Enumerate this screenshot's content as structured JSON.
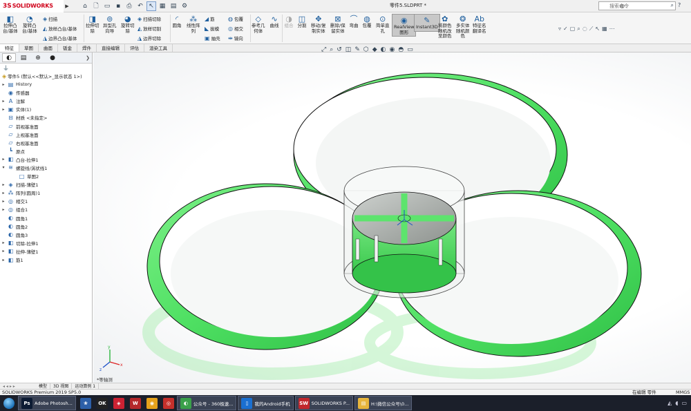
{
  "app": {
    "logo_mark": "3S",
    "logo_text": "SOLIDWORKS",
    "doc_title": "零件5.SLDPRT *",
    "search_placeholder": "搜索命令",
    "help": "?"
  },
  "ribbon": {
    "extrude_boss": "拉伸凸\n台/基体",
    "revolve_boss": "旋转凸\n台/基体",
    "sweep": "扫描",
    "loft": "放样凸台/基体",
    "boundary_boss": "边界凸台/基体",
    "extrude_cut": "拉伸切\n除",
    "hole_wizard": "异型孔\n向导",
    "revolve_cut": "旋转切\n除",
    "swept_cut": "扫描切除",
    "lofted_cut": "放样切割",
    "boundary_cut": "边界切除",
    "fillet": "圆角",
    "linear_pattern": "线性阵\n列",
    "rib": "筋",
    "draft": "拔模",
    "shell": "抽壳",
    "wrap": "包覆",
    "intersect": "相交",
    "mirror": "镜向",
    "ref_geometry": "参考几\n何体",
    "curves": "曲线",
    "combine": "组合",
    "split": "分割",
    "move_copy": "移动/复\n制实体",
    "delete_keep": "删除/保\n留实体",
    "flex": "弯曲",
    "wrap2": "包覆",
    "simple_hole": "简单直\n孔",
    "realview": "RealView\n图形",
    "instant3d": "Instant3D",
    "random_color": "将颜色\n随机改\n至颜色",
    "multi_body_color": "多实体\n随机颜\n色",
    "feature_rename": "特征名\n翻译名"
  },
  "tabs": [
    "特征",
    "草图",
    "曲面",
    "钣金",
    "焊件",
    "直接编辑",
    "评估",
    "渲染工具"
  ],
  "tree": {
    "root": "零件5 (默认<<默认>_显示状态 1>)",
    "items": [
      {
        "label": "History",
        "exp": "▸",
        "icon": "▤"
      },
      {
        "label": "传感器",
        "exp": "",
        "icon": "◉"
      },
      {
        "label": "注解",
        "exp": "▸",
        "icon": "A"
      },
      {
        "label": "实体(1)",
        "exp": "▸",
        "icon": "▣"
      },
      {
        "label": "材质 <未指定>",
        "exp": "",
        "icon": "⊟"
      },
      {
        "label": "前视基准面",
        "exp": "",
        "icon": "▱"
      },
      {
        "label": "上视基准面",
        "exp": "",
        "icon": "▱"
      },
      {
        "label": "右视基准面",
        "exp": "",
        "icon": "▱"
      },
      {
        "label": "原点",
        "exp": "",
        "icon": "┗"
      },
      {
        "label": "凸台-拉伸1",
        "exp": "▸",
        "icon": "◧"
      },
      {
        "label": "螺旋线/涡状线1",
        "exp": "▾",
        "icon": "≋"
      },
      {
        "label": "草图2",
        "exp": "",
        "icon": "□",
        "sub": true
      },
      {
        "label": "扫描-薄壁1",
        "exp": "▸",
        "icon": "◈"
      },
      {
        "label": "阵列(圆周)1",
        "exp": "▸",
        "icon": "⁂"
      },
      {
        "label": "相交1",
        "exp": "▸",
        "icon": "◎"
      },
      {
        "label": "组合1",
        "exp": "▸",
        "icon": "◎"
      },
      {
        "label": "圆角1",
        "exp": "",
        "icon": "◐"
      },
      {
        "label": "圆角2",
        "exp": "",
        "icon": "◐"
      },
      {
        "label": "圆角3",
        "exp": "",
        "icon": "◐"
      },
      {
        "label": "切除-拉伸1",
        "exp": "▸",
        "icon": "◧"
      },
      {
        "label": "拉伸-薄壁1",
        "exp": "▸",
        "icon": "◧"
      },
      {
        "label": "筋1",
        "exp": "▸",
        "icon": "◧"
      }
    ]
  },
  "viewport": {
    "view_label": "*等轴测",
    "axis_x": "x",
    "axis_y": "y",
    "axis_z": "z"
  },
  "bottom_tabs": [
    "模型",
    "3D 视图",
    "运动算例 1"
  ],
  "status": {
    "left": "SOLIDWORKS Premium 2019 SP5.0",
    "mode": "在编辑 零件",
    "units": "MMGS"
  },
  "taskbar": [
    {
      "label": "Adobe Photosh...",
      "icon": "Ps",
      "color": "#0c1b33",
      "open": true
    },
    {
      "label": "",
      "icon": "❀",
      "color": "#2c5fa8",
      "open": false
    },
    {
      "label": "",
      "icon": "OK",
      "color": "#222",
      "open": false
    },
    {
      "label": "",
      "icon": "◈",
      "color": "#c23",
      "open": false
    },
    {
      "label": "",
      "icon": "W",
      "color": "#b5282b",
      "open": false
    },
    {
      "label": "",
      "icon": "◉",
      "color": "#e6a21b",
      "open": false
    },
    {
      "label": "",
      "icon": "◎",
      "color": "#c4302b",
      "open": false
    },
    {
      "label": "公众号 - 360极速...",
      "icon": "◐",
      "color": "#3aa04a",
      "open": true
    },
    {
      "label": "我的Android手机",
      "icon": "▯",
      "color": "#1a6fd1",
      "open": true
    },
    {
      "label": "SOLIDWORKS P...",
      "icon": "SW",
      "color": "#c1272d",
      "open": true
    },
    {
      "label": "H:\\微信公众号\\0...",
      "icon": "▤",
      "color": "#e7b53c",
      "open": true
    }
  ],
  "colors": {
    "model_green": "#5ee86e",
    "model_green_dark": "#33c548",
    "hub_gray": "#8a8f8b",
    "accent": "#d0021b"
  }
}
